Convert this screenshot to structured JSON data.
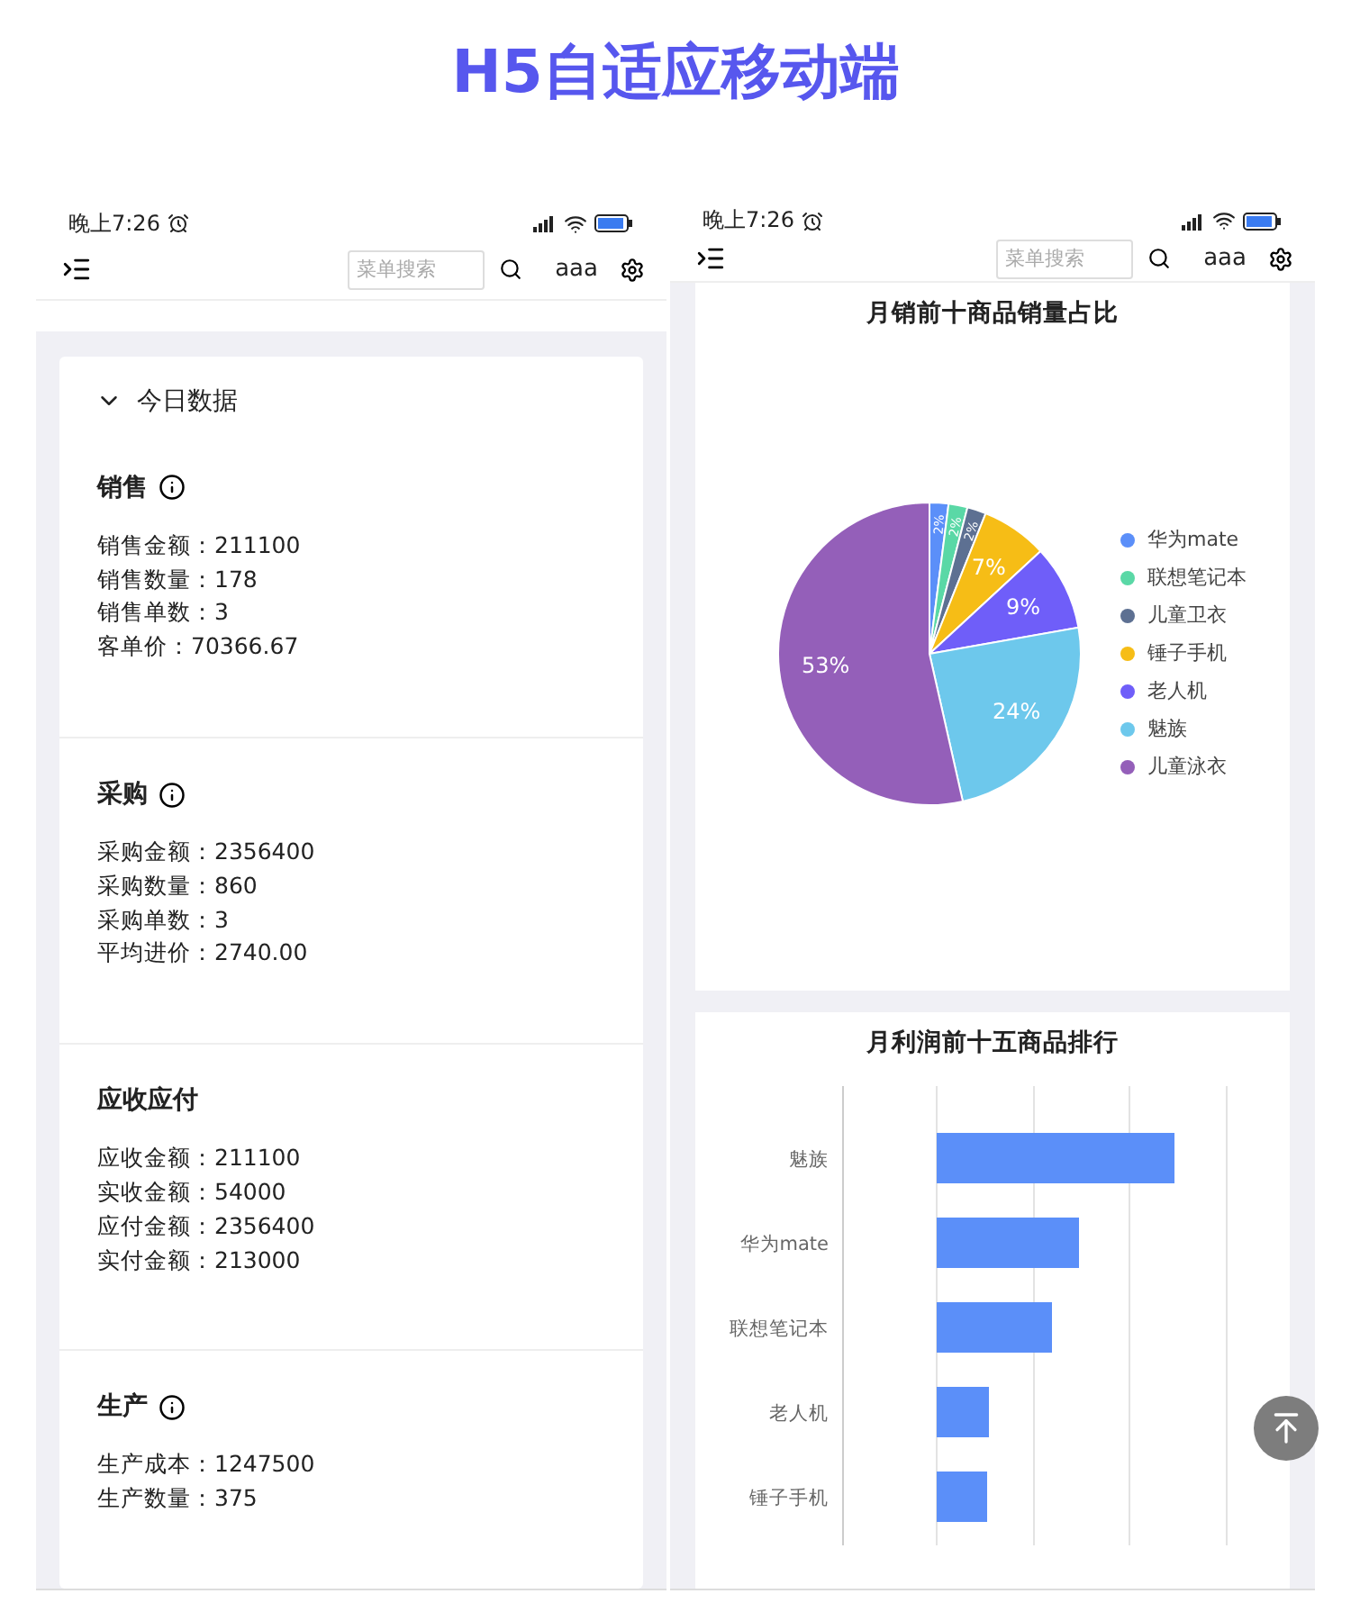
{
  "page_title": "H5自适应移动端",
  "phones": [
    {
      "status_bar": {
        "time": "晚上7:26"
      },
      "header": {
        "search_placeholder": "菜单搜索",
        "user": "aaa"
      }
    },
    {
      "status_bar": {
        "time": "晚上7:26"
      },
      "header": {
        "search_placeholder": "菜单搜索",
        "user": "aaa"
      }
    }
  ],
  "today_panel": {
    "title": "今日数据",
    "expanded": true,
    "sections": [
      {
        "title": "销售",
        "info": true,
        "lines": [
          "销售金额：211100",
          "销售数量：178",
          "销售单数：3",
          "客单价：70366.67"
        ]
      },
      {
        "title": "采购",
        "info": true,
        "lines": [
          "采购金额：2356400",
          "采购数量：860",
          "采购单数：3",
          "平均进价：2740.00"
        ]
      },
      {
        "title": "应收应付",
        "info": false,
        "lines": [
          "应收金额：211100",
          "实收金额：54000",
          "应付金额：2356400",
          "实付金额：213000"
        ]
      },
      {
        "title": "生产",
        "info": true,
        "lines": [
          "生产成本：1247500",
          "生产数量：375"
        ]
      }
    ]
  },
  "pie_card": {
    "chart_data": {
      "type": "pie",
      "title": "月销前十商品销量占比",
      "data_labels": true,
      "categories": [
        "华为mate",
        "联想笔记本",
        "儿童卫衣",
        "锤子手机",
        "老人机",
        "魅族",
        "儿童泳衣"
      ],
      "values": [
        2,
        2,
        2,
        7,
        9,
        24,
        53
      ],
      "value_labels": [
        "2%",
        "2%",
        "2%",
        "7%",
        "9%",
        "24%",
        "53%"
      ],
      "legend": true,
      "colors": [
        "#5b8ff9",
        "#5ad8a6",
        "#5d7092",
        "#f6bd16",
        "#6f5ef9",
        "#6dc8ec",
        "#945fb9"
      ]
    }
  },
  "bar_card": {
    "title": "月利润前十五商品排行",
    "categories": [
      "魅族",
      "华为mate",
      "联想笔记本",
      "老人机",
      "锤子手机"
    ]
  }
}
